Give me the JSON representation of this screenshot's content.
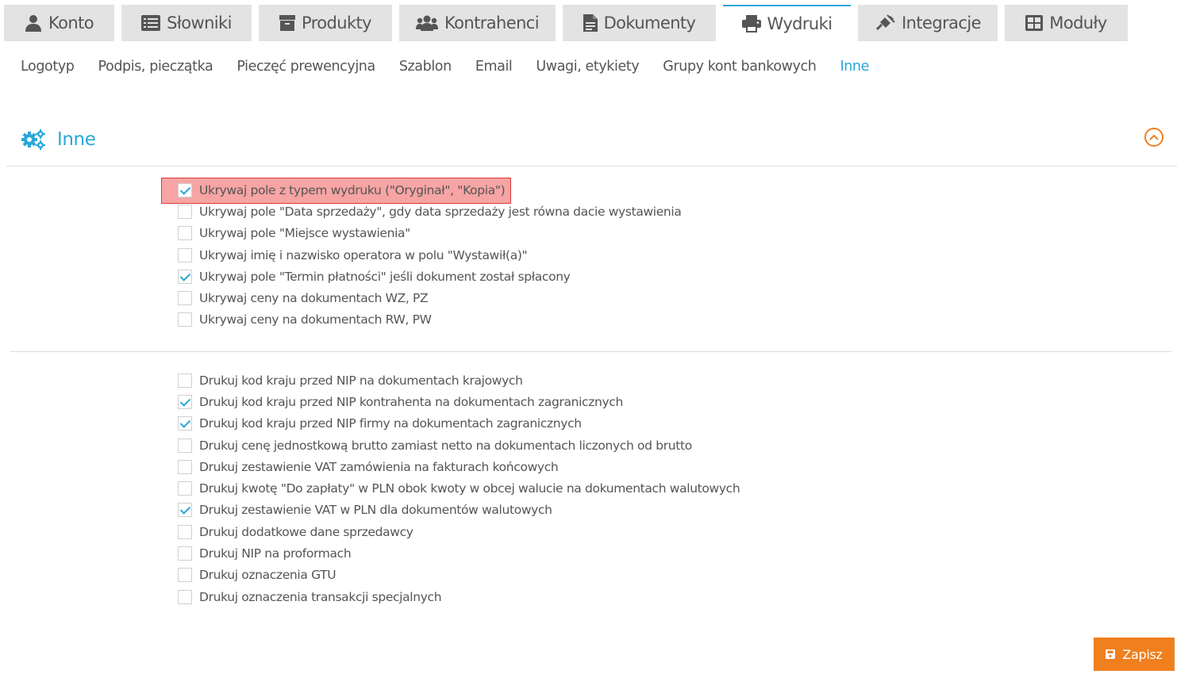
{
  "tabs": [
    {
      "label": "Konto",
      "icon": "user-icon"
    },
    {
      "label": "Słowniki",
      "icon": "list-icon"
    },
    {
      "label": "Produkty",
      "icon": "box-icon"
    },
    {
      "label": "Kontrahenci",
      "icon": "users-icon"
    },
    {
      "label": "Dokumenty",
      "icon": "document-icon"
    },
    {
      "label": "Wydruki",
      "icon": "printer-icon",
      "active": true
    },
    {
      "label": "Integracje",
      "icon": "plug-icon"
    },
    {
      "label": "Moduły",
      "icon": "grid-icon"
    }
  ],
  "subnav": [
    "Logotyp",
    "Podpis, pieczątka",
    "Pieczęć prewencyjna",
    "Szablon",
    "Email",
    "Uwagi, etykiety",
    "Grupy kont bankowych",
    "Inne"
  ],
  "subnav_active": "Inne",
  "section": {
    "title": "Inne",
    "icon": "gears-icon"
  },
  "group1": [
    {
      "label": "Ukrywaj pole z typem wydruku (\"Oryginał\", \"Kopia\")",
      "checked": true
    },
    {
      "label": "Ukrywaj pole \"Data sprzedaży\", gdy data sprzedaży jest równa dacie wystawienia",
      "checked": false
    },
    {
      "label": "Ukrywaj pole \"Miejsce wystawienia\"",
      "checked": false
    },
    {
      "label": "Ukrywaj imię i nazwisko operatora w polu \"Wystawił(a)\"",
      "checked": false
    },
    {
      "label": "Ukrywaj pole \"Termin płatności\" jeśli dokument został spłacony",
      "checked": true
    },
    {
      "label": "Ukrywaj ceny na dokumentach WZ, PZ",
      "checked": false
    },
    {
      "label": "Ukrywaj ceny na dokumentach RW, PW",
      "checked": false
    }
  ],
  "group2": [
    {
      "label": "Drukuj kod kraju przed NIP na dokumentach krajowych",
      "checked": false
    },
    {
      "label": "Drukuj kod kraju przed NIP kontrahenta na dokumentach zagranicznych",
      "checked": true
    },
    {
      "label": "Drukuj kod kraju przed NIP firmy na dokumentach zagranicznych",
      "checked": true
    },
    {
      "label": "Drukuj cenę jednostkową brutto zamiast netto na dokumentach liczonych od brutto",
      "checked": false
    },
    {
      "label": "Drukuj zestawienie VAT zamówienia na fakturach końcowych",
      "checked": false
    },
    {
      "label": "Drukuj kwotę \"Do zapłaty\" w PLN obok kwoty w obcej walucie na dokumentach walutowych",
      "checked": false
    },
    {
      "label": "Drukuj zestawienie VAT w PLN dla dokumentów walutowych",
      "checked": true
    },
    {
      "label": "Drukuj dodatkowe dane sprzedawcy",
      "checked": false
    },
    {
      "label": "Drukuj NIP na proformach",
      "checked": false
    },
    {
      "label": "Drukuj oznaczenia GTU",
      "checked": false
    },
    {
      "label": "Drukuj oznaczenia transakcji specjalnych",
      "checked": false
    }
  ],
  "save_button": {
    "label": "Zapisz",
    "icon": "floppy-icon"
  },
  "colors": {
    "accent": "#29a7d9",
    "orange": "#f07f1e",
    "tab_bg": "#e3e3e3",
    "highlight": "#f05a5a"
  }
}
